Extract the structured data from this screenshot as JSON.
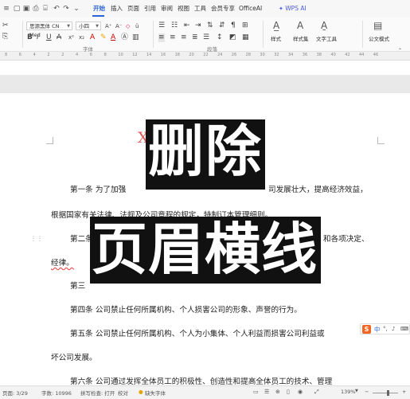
{
  "quickbar": {
    "tabs": [
      "开始",
      "插入",
      "页面",
      "引用",
      "审阅",
      "视图",
      "工具",
      "会员专享",
      "OfficeAI",
      "WPS AI"
    ]
  },
  "ribbon": {
    "font_name": "思源黑体 CN Med",
    "font_size": "小四",
    "group_font": "字体",
    "group_paragraph": "段落",
    "style_label": "样式",
    "style_set_label": "样式集",
    "text_tools_label": "文字工具",
    "formula_style_label": "公文模式"
  },
  "ruler": {
    "numbers": [
      "8",
      "6",
      "4",
      "2",
      "2",
      "4",
      "6",
      "8",
      "10",
      "12",
      "14",
      "16",
      "18",
      "20",
      "22",
      "24",
      "26",
      "28",
      "30",
      "32",
      "34",
      "36",
      "38",
      "40",
      "42",
      "44",
      "46"
    ]
  },
  "document": {
    "header_text": "X      公司",
    "lines": [
      "第一条    为了加强",
      "司发展壮大，提高经济效益，",
      "根据国家有关法律、法规及公司章程的规定，特制订本管理细则。",
      "第二条",
      "和各项决定、",
      "经律。",
      "第三",
      "第四条    公司禁止任何所属机构、个人损害公司的形象、声誉的行为。",
      "第五条    公司禁止任何所属机构、个人为小集体、个人利益而损害公司利益或",
      "坏公司发展。",
      "第六条    公司通过发挥全体员工的积极性、创造性和提高全体员工的技术、管理"
    ]
  },
  "overlay": {
    "line1": "删除",
    "line2": "页眉横线"
  },
  "ime": {
    "logo": "S",
    "mode": "中"
  },
  "statusbar": {
    "page": "页面: 3/29",
    "words": "字数: 10996",
    "spell": "拼写检查: 打开",
    "proof": "校对",
    "missing_font": "缺失字体",
    "zoom": "139%"
  },
  "colors": {
    "accent": "#2b63d9",
    "header_red": "#e05a5a",
    "sogou_orange": "#f26522"
  }
}
